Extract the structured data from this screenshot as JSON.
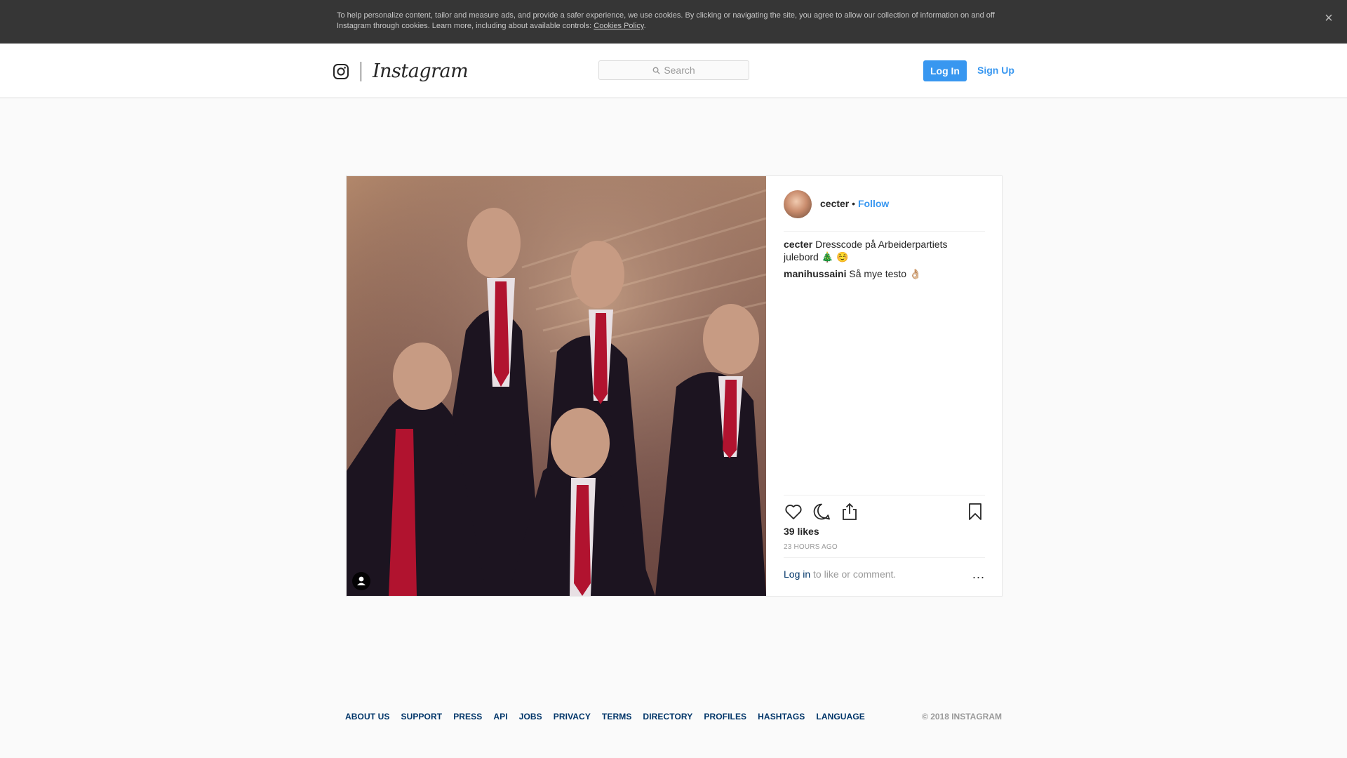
{
  "cookie_banner": {
    "text": "To help personalize content, tailor and measure ads, and provide a safer experience, we use cookies. By clicking or navigating the site, you agree to allow our collection of information on and off Instagram through cookies. Learn more, including about available controls: ",
    "link": "Cookies Policy",
    "close_icon": "close-icon"
  },
  "header": {
    "logo_icon": "instagram-glyph-icon",
    "wordmark": "Instagram",
    "search_placeholder": "Search",
    "login_label": "Log In",
    "signup_label": "Sign Up"
  },
  "post": {
    "username": "cecter",
    "separator": "•",
    "follow_label": "Follow",
    "comments": [
      {
        "user": "cecter",
        "text": "Dresscode på Arbeiderpartiets julebord 🎄 ☺️"
      },
      {
        "user": "manihussaini",
        "text": "Så mye testo 👌🏼"
      }
    ],
    "likes": "39 likes",
    "timestamp": "23 HOURS AGO",
    "login_link": "Log in",
    "login_suffix": " to like or comment.",
    "more_label": "..."
  },
  "footer": {
    "links": [
      "ABOUT US",
      "SUPPORT",
      "PRESS",
      "API",
      "JOBS",
      "PRIVACY",
      "TERMS",
      "DIRECTORY",
      "PROFILES",
      "HASHTAGS",
      "LANGUAGE"
    ],
    "copyright": "© 2018 INSTAGRAM"
  },
  "colors": {
    "accent": "#3897f0",
    "link_dark": "#003569",
    "cookie_bg": "#363636"
  }
}
